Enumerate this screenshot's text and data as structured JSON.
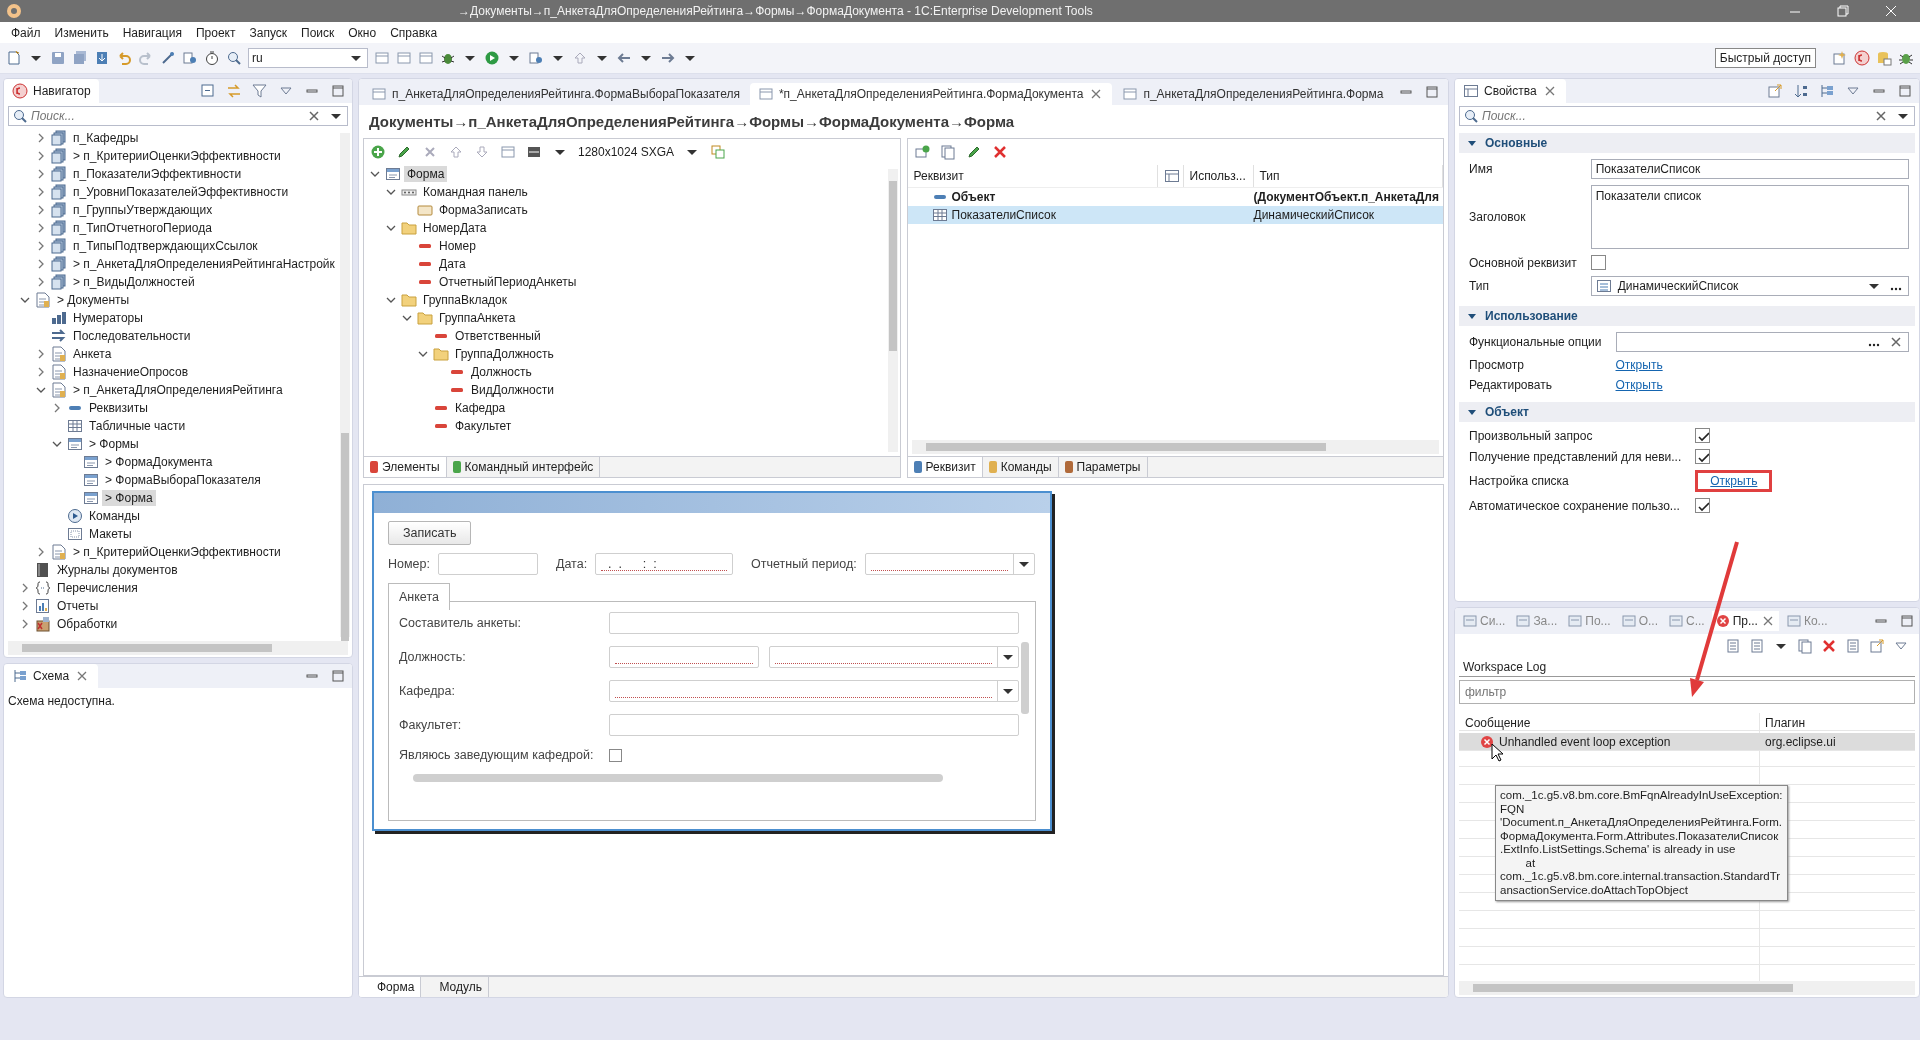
{
  "window": {
    "title": "→Документы→п_АнкетаДляОпределенияРейтинга→Формы→ФормаДокумента - 1C:Enterprise Development Tools"
  },
  "menu": [
    "Файл",
    "Изменить",
    "Навигация",
    "Проект",
    "Запуск",
    "Поиск",
    "Окно",
    "Справка"
  ],
  "toolbar": {
    "language": "ru",
    "quick_access": "Быстрый доступ"
  },
  "navigator": {
    "title": "Навигатор",
    "search": {
      "placeholder": "Поиск..."
    },
    "nested_items": [
      {
        "label": "п_Кафедры",
        "expanded": false,
        "kind": "catalog",
        "selected": false
      },
      {
        "label": "> п_КритерииОценкиЭффективности",
        "expanded": false,
        "kind": "catalog",
        "selected": false
      },
      {
        "label": "п_ПоказателиЭффективности",
        "expanded": false,
        "kind": "catalog",
        "selected": false
      },
      {
        "label": "п_УровниПоказателейЭффективности",
        "expanded": false,
        "kind": "catalog",
        "selected": false
      },
      {
        "label": "п_ГруппыУтверждающих",
        "expanded": false,
        "kind": "catalog",
        "selected": false
      },
      {
        "label": "п_ТипОтчетногоПериода",
        "expanded": false,
        "kind": "catalog",
        "selected": false
      },
      {
        "label": "п_ТипыПодтверждающихСсылок",
        "expanded": false,
        "kind": "catalog",
        "selected": false
      },
      {
        "label": "> п_АнкетаДляОпределенияРейтингаНастройк",
        "expanded": false,
        "kind": "catalog",
        "selected": false
      },
      {
        "label": "> п_ВидыДолжностей",
        "expanded": false,
        "kind": "catalog",
        "selected": false
      }
    ],
    "items": [
      {
        "label": "> Документы",
        "expanded": true,
        "kind": "document",
        "selected": false,
        "children": [
          {
            "label": "Нумераторы",
            "kind": "numerator",
            "selected": false
          },
          {
            "label": "Последовательности",
            "kind": "sequence",
            "selected": false
          },
          {
            "label": "Анкета",
            "expanded": false,
            "kind": "document",
            "selected": false
          },
          {
            "label": "НазначениеОпросов",
            "expanded": false,
            "kind": "document",
            "selected": false
          },
          {
            "label": "> п_АнкетаДляОпределенияРейтинга",
            "expanded": true,
            "kind": "document",
            "selected": false,
            "children": [
              {
                "label": "Реквизиты",
                "expanded": false,
                "kind": "attributes",
                "selected": false
              },
              {
                "label": "Табличные части",
                "kind": "table",
                "selected": false
              },
              {
                "label": "> Формы",
                "expanded": true,
                "kind": "forms",
                "selected": false,
                "children": [
                  {
                    "label": "> ФормаДокумента",
                    "kind": "forms",
                    "selected": false
                  },
                  {
                    "label": "> ФормаВыбораПоказателя",
                    "kind": "forms",
                    "selected": false
                  },
                  {
                    "label": "> Форма",
                    "kind": "forms",
                    "selected": true
                  }
                ]
              },
              {
                "label": "Команды",
                "kind": "commands",
                "selected": false
              },
              {
                "label": "Макеты",
                "kind": "templates",
                "selected": false
              }
            ]
          },
          {
            "label": "> п_КритерийОценкиЭффективности",
            "expanded": false,
            "kind": "document",
            "selected": false
          }
        ]
      },
      {
        "label": "Журналы документов",
        "kind": "journal",
        "selected": false
      },
      {
        "label": "Перечисления",
        "expanded": false,
        "kind": "enum",
        "selected": false
      },
      {
        "label": "Отчеты",
        "expanded": false,
        "kind": "report",
        "selected": false
      },
      {
        "label": "Обработки",
        "expanded": false,
        "kind": "processing",
        "selected": false
      }
    ]
  },
  "schema": {
    "title": "Схема",
    "message": "Схема недоступна."
  },
  "editor": {
    "tabs": [
      {
        "label": "п_АнкетаДляОпределенияРейтинга.ФормаВыбораПоказателя",
        "selected": false,
        "closable": false
      },
      {
        "label": "*п_АнкетаДляОпределенияРейтинга.ФормаДокумента",
        "selected": true,
        "closable": true
      },
      {
        "label": "п_АнкетаДляОпределенияРейтинга.Форма",
        "selected": false,
        "closable": false
      }
    ],
    "heading": "Документы→п_АнкетаДляОпределенияРейтинга→Формы→ФормаДокумента→Форма",
    "elements": {
      "resolution": "1280x1024 SXGA",
      "tree": [
        {
          "label": "Форма",
          "expanded": true,
          "kind": "forms",
          "selected": true,
          "children": [
            {
              "label": "Командная панель",
              "expanded": true,
              "kind": "cmdbar",
              "selected": false,
              "children": [
                {
                  "label": "ФормаЗаписать",
                  "kind": "button",
                  "selected": false
                }
              ]
            },
            {
              "label": "НомерДата",
              "expanded": true,
              "kind": "folder",
              "selected": false,
              "children": [
                {
                  "label": "Номер",
                  "kind": "field",
                  "selected": false
                },
                {
                  "label": "Дата",
                  "kind": "field",
                  "selected": false
                },
                {
                  "label": "ОтчетныйПериодАнкеты",
                  "kind": "field",
                  "selected": false
                }
              ]
            },
            {
              "label": "ГруппаВкладок",
              "expanded": true,
              "kind": "folder",
              "selected": false,
              "children": [
                {
                  "label": "ГруппаАнкета",
                  "expanded": true,
                  "kind": "folder",
                  "selected": false,
                  "children": [
                    {
                      "label": "Ответственный",
                      "kind": "field",
                      "selected": false
                    },
                    {
                      "label": "ГруппаДолжность",
                      "expanded": true,
                      "kind": "folder",
                      "selected": false,
                      "children": [
                        {
                          "label": "Должность",
                          "kind": "field",
                          "selected": false
                        },
                        {
                          "label": "ВидДолжности",
                          "kind": "field",
                          "selected": false
                        }
                      ]
                    },
                    {
                      "label": "Кафедра",
                      "kind": "field",
                      "selected": false
                    },
                    {
                      "label": "Факультет",
                      "kind": "field",
                      "selected": false
                    }
                  ]
                }
              ]
            }
          ]
        }
      ],
      "tabs": [
        {
          "label": "Элементы",
          "selected": true
        },
        {
          "label": "Командный интерфейс",
          "selected": false
        }
      ]
    },
    "attributes": {
      "columns": [
        "Реквизит",
        "Использ...",
        "Тип"
      ],
      "rows": [
        {
          "name": "Объект",
          "type": "(ДокументОбъект.п_АнкетаДля",
          "main": true,
          "selected": false
        },
        {
          "name": "ПоказателиСписок",
          "type": "ДинамическийСписок",
          "main": false,
          "selected": true
        }
      ],
      "tabs": [
        {
          "label": "Реквизит",
          "selected": true
        },
        {
          "label": "Команды",
          "selected": false
        },
        {
          "label": "Параметры",
          "selected": false
        }
      ]
    },
    "preview": {
      "button": "Записать",
      "header_fields": [
        {
          "label": "Номер:",
          "kind": "input",
          "required": false
        },
        {
          "label": "Дата:",
          "kind": "input",
          "value": "  .  .      :  :",
          "required": true
        },
        {
          "label": "Отчетный период:",
          "kind": "select",
          "required": true
        }
      ],
      "tabs": [
        {
          "label": "Анкета",
          "selected": true
        }
      ],
      "fields": [
        {
          "label": "Составитель анкеты:",
          "kind": "input",
          "required": false
        },
        {
          "label": "Должность:",
          "kind": "pair",
          "required": true
        },
        {
          "label": "Кафедра:",
          "kind": "select",
          "required": true
        },
        {
          "label": "Факультет:",
          "kind": "input",
          "required": false
        },
        {
          "label": "Являюсь заведующим кафедрой:",
          "kind": "checkbox",
          "checked": false
        }
      ]
    },
    "bottom_tabs": [
      {
        "label": "Форма",
        "selected": true
      },
      {
        "label": "Модуль",
        "selected": false
      }
    ]
  },
  "properties": {
    "title": "Свойства",
    "search": {
      "placeholder": "Поиск..."
    },
    "sections": [
      {
        "title": "Основные",
        "expanded": true,
        "rows": [
          {
            "label": "Имя",
            "kind": "field",
            "value": "ПоказателиСписок",
            "highlighted": false
          },
          {
            "label": "Заголовок",
            "kind": "textarea",
            "value": "Показатели список",
            "highlighted": false
          },
          {
            "label": "Основной реквизит",
            "kind": "checkbox",
            "checked": false,
            "highlighted": false
          },
          {
            "label": "Тип",
            "kind": "combo",
            "value": "ДинамическийСписок",
            "highlighted": false
          }
        ]
      },
      {
        "title": "Использование",
        "expanded": true,
        "rows": [
          {
            "label": "Функциональные опции",
            "kind": "options",
            "highlighted": false
          },
          {
            "label": "Просмотр",
            "kind": "link",
            "value": "Открыть",
            "highlighted": false
          },
          {
            "label": "Редактировать",
            "kind": "link",
            "value": "Открыть",
            "highlighted": false
          }
        ]
      },
      {
        "title": "Объект",
        "expanded": true,
        "rows": [
          {
            "label": "Произвольный запрос",
            "kind": "checkbox",
            "checked": true,
            "highlighted": false
          },
          {
            "label": "Получение представлений для неви...",
            "kind": "checkbox",
            "checked": true,
            "highlighted": false
          },
          {
            "label": "Настройка списка",
            "kind": "link",
            "value": "Открыть",
            "highlighted": true
          },
          {
            "label": "Автоматическое сохранение пользо...",
            "kind": "checkbox",
            "checked": true,
            "highlighted": false
          }
        ]
      }
    ]
  },
  "log": {
    "tabs": [
      {
        "label": "Си...",
        "selected": false
      },
      {
        "label": "За...",
        "selected": false
      },
      {
        "label": "По...",
        "selected": false
      },
      {
        "label": "О...",
        "selected": false
      },
      {
        "label": "С...",
        "selected": false
      },
      {
        "label": "Пр...",
        "selected": true
      },
      {
        "label": "Ко...",
        "selected": false
      }
    ],
    "title": "Workspace Log",
    "filter": {
      "placeholder": "фильтр"
    },
    "columns": [
      "Сообщение",
      "Плагин"
    ],
    "rows": [
      {
        "message": "Unhandled event loop exception",
        "plugin": "org.eclipse.ui",
        "selected": true
      }
    ],
    "tooltip": "com._1c.g5.v8.bm.core.BmFqnAlreadyInUseException:\nFQN\n'Document.п_АнкетаДляОпределенияРейтинга.Form.\nФормаДокумента.Form.Attributes.ПоказателиСписок\n.ExtInfo.ListSettings.Schema' is already in use\n        at\ncom._1c.g5.v8.bm.core.internal.transaction.StandardTr\nansactionService.doAttachTopObject"
  }
}
